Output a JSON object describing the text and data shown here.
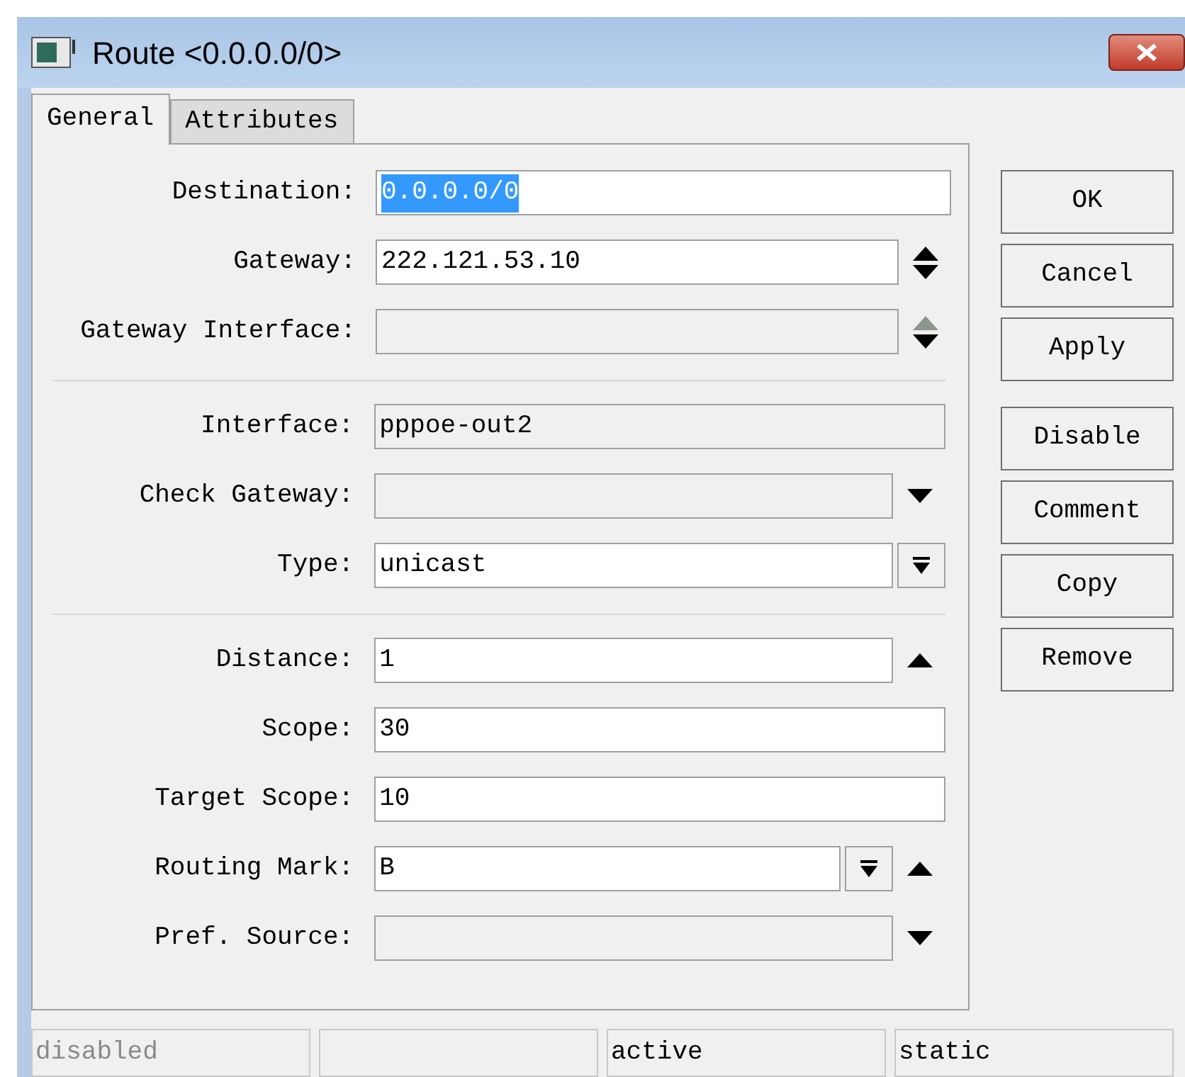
{
  "window": {
    "title": "Route <0.0.0.0/0>"
  },
  "tabs": [
    {
      "label": "General",
      "selected": true
    },
    {
      "label": "Attributes",
      "selected": false
    }
  ],
  "sections": [
    [
      {
        "label": "Destination:",
        "value": "0.0.0.0/0",
        "editable": true,
        "selected": true,
        "dropdown": false,
        "kind": "plain"
      },
      {
        "label": "Gateway:",
        "value": "222.121.53.10",
        "editable": true,
        "dropdown": false,
        "kind": "updown"
      },
      {
        "label": "Gateway Interface:",
        "editable": false,
        "dropdown": false,
        "kind": "updowndim"
      }
    ],
    [
      {
        "label": "Interface:",
        "value": "pppoe-out2",
        "editable": false,
        "dropdown": false,
        "kind": "plain"
      },
      {
        "label": "Check Gateway:",
        "editable": false,
        "dropdown": false,
        "kind": "down"
      },
      {
        "label": "Type:",
        "value": "unicast",
        "editable": true,
        "dropdown": true,
        "kind": "plain"
      }
    ],
    [
      {
        "label": "Distance:",
        "value": "1",
        "editable": true,
        "dropdown": false,
        "kind": "up"
      },
      {
        "label": "Scope:",
        "value": "30",
        "editable": true,
        "dropdown": false,
        "kind": "plain"
      },
      {
        "label": "Target Scope:",
        "value": "10",
        "editable": true,
        "dropdown": false,
        "kind": "plain"
      },
      {
        "label": "Routing Mark:",
        "value": "B",
        "editable": true,
        "dropdown": true,
        "kind": "up"
      },
      {
        "label": "Pref. Source:",
        "editable": false,
        "dropdown": false,
        "kind": "down"
      }
    ]
  ],
  "button_groups": [
    [
      "OK",
      "Cancel",
      "Apply"
    ],
    [
      "Disable",
      "Comment",
      "Copy",
      "Remove"
    ]
  ],
  "status_bar": [
    {
      "kind": "text",
      "text": "disabled",
      "dim": true
    },
    {
      "kind": "blank"
    },
    {
      "kind": "text",
      "text": "active",
      "dim": false
    },
    {
      "kind": "text",
      "text": "static",
      "dim": false
    }
  ]
}
